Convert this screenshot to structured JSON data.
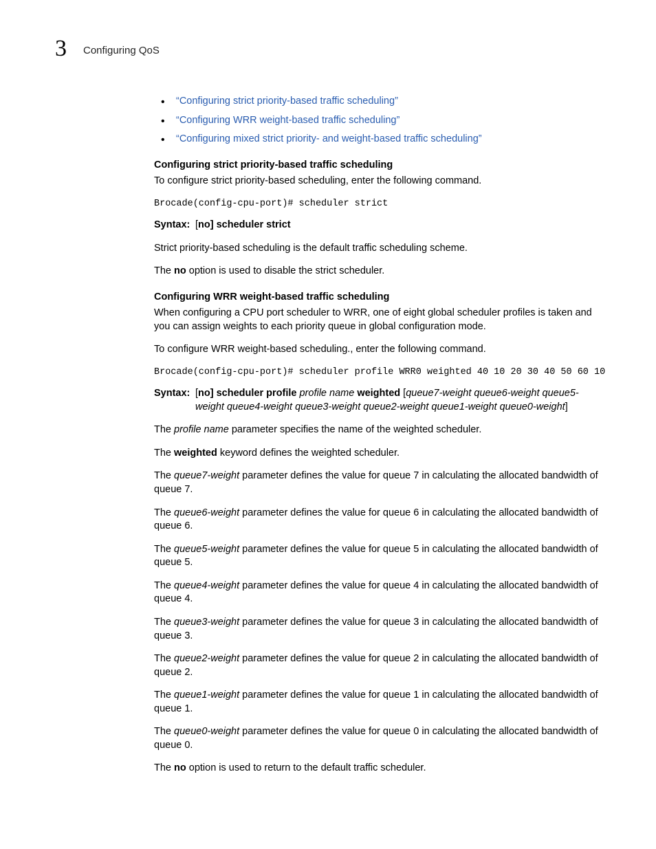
{
  "header": {
    "chapter_number": "3",
    "chapter_title": "Configuring QoS"
  },
  "bullets": [
    "“Configuring strict priority-based traffic scheduling”",
    "“Configuring WRR weight-based traffic scheduling”",
    "“Configuring mixed strict priority- and weight-based traffic scheduling”"
  ],
  "sec1": {
    "heading": "Configuring strict priority-based traffic scheduling",
    "intro": "To configure strict priority-based scheduling, enter the following command.",
    "code": "Brocade(config-cpu-port)# scheduler strict",
    "syntax_label": "Syntax:",
    "syntax_body_pre": "[",
    "syntax_no": "no",
    "syntax_body_post": "] scheduler strict",
    "note1": "Strict priority-based scheduling is the default traffic scheduling scheme.",
    "note2_pre": "The ",
    "note2_bold": "no",
    "note2_post": " option is used to disable the strict scheduler."
  },
  "sec2": {
    "heading": "Configuring WRR weight-based traffic scheduling",
    "intro": "When configuring a CPU port scheduler to WRR, one of eight global scheduler profiles is taken and you can assign weights to each priority queue in global configuration mode.",
    "intro2": "To configure WRR weight-based scheduling., enter the following command.",
    "code": "Brocade(config-cpu-port)# scheduler profile WRR0 weighted 40 10 20 30 40 50 60 10",
    "syntax_label": "Syntax:",
    "syn_pre": "[",
    "syn_no": "no",
    "syn_mid1": "] scheduler profile",
    "syn_ital1": " profile name ",
    "syn_bold2": "weighted",
    "syn_mid2": " [",
    "syn_ital2": "queue7-weight queue6-weight queue5-weight queue4-weight queue3-weight queue2-weight queue1-weight queue0-weight",
    "syn_post": "]",
    "p_profile_pre": "The ",
    "p_profile_ital": "profile name",
    "p_profile_post": " parameter specifies the name of the weighted scheduler.",
    "p_weighted_pre": "The ",
    "p_weighted_bold": "weighted",
    "p_weighted_post": " keyword defines the weighted scheduler.",
    "queues": [
      {
        "pre": "The ",
        "ital": "queue7-weight",
        "post": " parameter defines the value for queue 7 in calculating the allocated bandwidth of queue 7."
      },
      {
        "pre": "The ",
        "ital": "queue6-weight",
        "post": " parameter defines the value for queue 6 in calculating the allocated bandwidth of queue 6."
      },
      {
        "pre": "The ",
        "ital": "queue5-weight",
        "post": " parameter defines the value for queue 5 in calculating the allocated bandwidth of queue 5."
      },
      {
        "pre": "The ",
        "ital": "queue4-weight",
        "post": " parameter defines the value for queue 4 in calculating the allocated bandwidth of queue 4."
      },
      {
        "pre": "The ",
        "ital": "queue3-weight",
        "post": " parameter defines the value for queue 3 in calculating the allocated bandwidth of queue 3."
      },
      {
        "pre": "The ",
        "ital": "queue2-weight",
        "post": " parameter defines the value for queue 2 in calculating the allocated bandwidth of queue 2."
      },
      {
        "pre": "The ",
        "ital": "queue1-weight",
        "post": " parameter defines the value for queue 1 in calculating the allocated bandwidth of queue 1."
      },
      {
        "pre": "The ",
        "ital": "queue0-weight",
        "post": " parameter defines the value for queue 0 in calculating the allocated bandwidth of queue 0."
      }
    ],
    "p_no_pre": "The ",
    "p_no_bold": "no",
    "p_no_post": " option is used to return to the default traffic scheduler."
  }
}
